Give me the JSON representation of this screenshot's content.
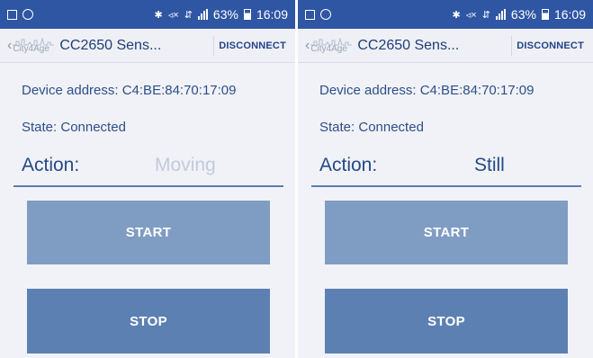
{
  "status_bar": {
    "time": "16:09",
    "battery": "63%",
    "icons": [
      "notification-icon",
      "whatsapp-icon",
      "bluetooth-icon",
      "mute-icon",
      "network-icon",
      "signal-icon",
      "battery-icon"
    ]
  },
  "toolbar": {
    "logo_text": "City4Age",
    "title": "CC2650 Sens...",
    "disconnect_label": "DISCONNECT"
  },
  "screens": [
    {
      "device_address": "Device address: C4:BE:84:70:17:09",
      "state": "State: Connected",
      "action_label": "Action:",
      "action_value": "Moving",
      "action_value_color": "#c3cad9",
      "start_label": "START",
      "stop_label": "STOP"
    },
    {
      "device_address": "Device address: C4:BE:84:70:17:09",
      "state": "State: Connected",
      "action_label": "Action:",
      "action_value": "Still",
      "action_value_color": "#234a86",
      "start_label": "START",
      "stop_label": "STOP"
    }
  ],
  "colors": {
    "status_bar_bg": "#2f56a3",
    "start_button_bg": "#7f9cc3",
    "stop_button_bg": "#5d80b3",
    "text_primary": "#234a86"
  }
}
